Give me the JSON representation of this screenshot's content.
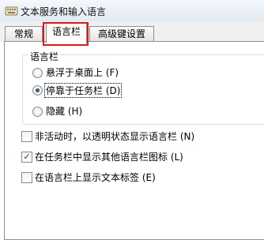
{
  "window": {
    "title": "文本服务和输入语言",
    "icon": "keyboard-icon"
  },
  "tabs": [
    {
      "label": "常规"
    },
    {
      "label": "语言栏",
      "selected": true
    },
    {
      "label": "高级键设置"
    }
  ],
  "language_bar": {
    "group_label": "语言栏",
    "options": [
      {
        "label": "悬浮于桌面上 (F)",
        "selected": false
      },
      {
        "label": "停靠于任务栏 (D)",
        "selected": true
      },
      {
        "label": "隐藏 (H)",
        "selected": false
      }
    ]
  },
  "checkboxes": [
    {
      "label": "非活动时，以透明状态显示语言栏 (N)",
      "checked": false
    },
    {
      "label": "在任务栏中显示其他语言栏图标 (L)",
      "checked": true
    },
    {
      "label": "在语言栏上显示文本标签 (E)",
      "checked": false
    }
  ],
  "colors": {
    "highlight": "#d7191b",
    "tab_border": "#8e8f8f",
    "groupbox_border": "#d5dfe5"
  }
}
